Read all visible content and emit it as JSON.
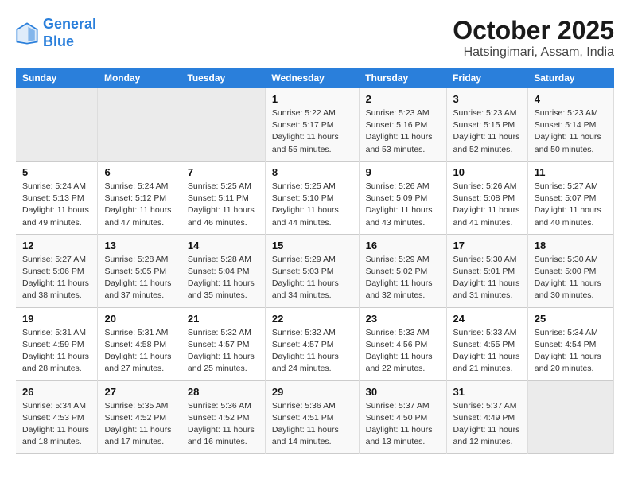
{
  "header": {
    "logo_line1": "General",
    "logo_line2": "Blue",
    "month": "October 2025",
    "location": "Hatsingimari, Assam, India"
  },
  "weekdays": [
    "Sunday",
    "Monday",
    "Tuesday",
    "Wednesday",
    "Thursday",
    "Friday",
    "Saturday"
  ],
  "weeks": [
    [
      {
        "day": "",
        "sunrise": "",
        "sunset": "",
        "daylight": ""
      },
      {
        "day": "",
        "sunrise": "",
        "sunset": "",
        "daylight": ""
      },
      {
        "day": "",
        "sunrise": "",
        "sunset": "",
        "daylight": ""
      },
      {
        "day": "1",
        "sunrise": "Sunrise: 5:22 AM",
        "sunset": "Sunset: 5:17 PM",
        "daylight": "Daylight: 11 hours and 55 minutes."
      },
      {
        "day": "2",
        "sunrise": "Sunrise: 5:23 AM",
        "sunset": "Sunset: 5:16 PM",
        "daylight": "Daylight: 11 hours and 53 minutes."
      },
      {
        "day": "3",
        "sunrise": "Sunrise: 5:23 AM",
        "sunset": "Sunset: 5:15 PM",
        "daylight": "Daylight: 11 hours and 52 minutes."
      },
      {
        "day": "4",
        "sunrise": "Sunrise: 5:23 AM",
        "sunset": "Sunset: 5:14 PM",
        "daylight": "Daylight: 11 hours and 50 minutes."
      }
    ],
    [
      {
        "day": "5",
        "sunrise": "Sunrise: 5:24 AM",
        "sunset": "Sunset: 5:13 PM",
        "daylight": "Daylight: 11 hours and 49 minutes."
      },
      {
        "day": "6",
        "sunrise": "Sunrise: 5:24 AM",
        "sunset": "Sunset: 5:12 PM",
        "daylight": "Daylight: 11 hours and 47 minutes."
      },
      {
        "day": "7",
        "sunrise": "Sunrise: 5:25 AM",
        "sunset": "Sunset: 5:11 PM",
        "daylight": "Daylight: 11 hours and 46 minutes."
      },
      {
        "day": "8",
        "sunrise": "Sunrise: 5:25 AM",
        "sunset": "Sunset: 5:10 PM",
        "daylight": "Daylight: 11 hours and 44 minutes."
      },
      {
        "day": "9",
        "sunrise": "Sunrise: 5:26 AM",
        "sunset": "Sunset: 5:09 PM",
        "daylight": "Daylight: 11 hours and 43 minutes."
      },
      {
        "day": "10",
        "sunrise": "Sunrise: 5:26 AM",
        "sunset": "Sunset: 5:08 PM",
        "daylight": "Daylight: 11 hours and 41 minutes."
      },
      {
        "day": "11",
        "sunrise": "Sunrise: 5:27 AM",
        "sunset": "Sunset: 5:07 PM",
        "daylight": "Daylight: 11 hours and 40 minutes."
      }
    ],
    [
      {
        "day": "12",
        "sunrise": "Sunrise: 5:27 AM",
        "sunset": "Sunset: 5:06 PM",
        "daylight": "Daylight: 11 hours and 38 minutes."
      },
      {
        "day": "13",
        "sunrise": "Sunrise: 5:28 AM",
        "sunset": "Sunset: 5:05 PM",
        "daylight": "Daylight: 11 hours and 37 minutes."
      },
      {
        "day": "14",
        "sunrise": "Sunrise: 5:28 AM",
        "sunset": "Sunset: 5:04 PM",
        "daylight": "Daylight: 11 hours and 35 minutes."
      },
      {
        "day": "15",
        "sunrise": "Sunrise: 5:29 AM",
        "sunset": "Sunset: 5:03 PM",
        "daylight": "Daylight: 11 hours and 34 minutes."
      },
      {
        "day": "16",
        "sunrise": "Sunrise: 5:29 AM",
        "sunset": "Sunset: 5:02 PM",
        "daylight": "Daylight: 11 hours and 32 minutes."
      },
      {
        "day": "17",
        "sunrise": "Sunrise: 5:30 AM",
        "sunset": "Sunset: 5:01 PM",
        "daylight": "Daylight: 11 hours and 31 minutes."
      },
      {
        "day": "18",
        "sunrise": "Sunrise: 5:30 AM",
        "sunset": "Sunset: 5:00 PM",
        "daylight": "Daylight: 11 hours and 30 minutes."
      }
    ],
    [
      {
        "day": "19",
        "sunrise": "Sunrise: 5:31 AM",
        "sunset": "Sunset: 4:59 PM",
        "daylight": "Daylight: 11 hours and 28 minutes."
      },
      {
        "day": "20",
        "sunrise": "Sunrise: 5:31 AM",
        "sunset": "Sunset: 4:58 PM",
        "daylight": "Daylight: 11 hours and 27 minutes."
      },
      {
        "day": "21",
        "sunrise": "Sunrise: 5:32 AM",
        "sunset": "Sunset: 4:57 PM",
        "daylight": "Daylight: 11 hours and 25 minutes."
      },
      {
        "day": "22",
        "sunrise": "Sunrise: 5:32 AM",
        "sunset": "Sunset: 4:57 PM",
        "daylight": "Daylight: 11 hours and 24 minutes."
      },
      {
        "day": "23",
        "sunrise": "Sunrise: 5:33 AM",
        "sunset": "Sunset: 4:56 PM",
        "daylight": "Daylight: 11 hours and 22 minutes."
      },
      {
        "day": "24",
        "sunrise": "Sunrise: 5:33 AM",
        "sunset": "Sunset: 4:55 PM",
        "daylight": "Daylight: 11 hours and 21 minutes."
      },
      {
        "day": "25",
        "sunrise": "Sunrise: 5:34 AM",
        "sunset": "Sunset: 4:54 PM",
        "daylight": "Daylight: 11 hours and 20 minutes."
      }
    ],
    [
      {
        "day": "26",
        "sunrise": "Sunrise: 5:34 AM",
        "sunset": "Sunset: 4:53 PM",
        "daylight": "Daylight: 11 hours and 18 minutes."
      },
      {
        "day": "27",
        "sunrise": "Sunrise: 5:35 AM",
        "sunset": "Sunset: 4:52 PM",
        "daylight": "Daylight: 11 hours and 17 minutes."
      },
      {
        "day": "28",
        "sunrise": "Sunrise: 5:36 AM",
        "sunset": "Sunset: 4:52 PM",
        "daylight": "Daylight: 11 hours and 16 minutes."
      },
      {
        "day": "29",
        "sunrise": "Sunrise: 5:36 AM",
        "sunset": "Sunset: 4:51 PM",
        "daylight": "Daylight: 11 hours and 14 minutes."
      },
      {
        "day": "30",
        "sunrise": "Sunrise: 5:37 AM",
        "sunset": "Sunset: 4:50 PM",
        "daylight": "Daylight: 11 hours and 13 minutes."
      },
      {
        "day": "31",
        "sunrise": "Sunrise: 5:37 AM",
        "sunset": "Sunset: 4:49 PM",
        "daylight": "Daylight: 11 hours and 12 minutes."
      },
      {
        "day": "",
        "sunrise": "",
        "sunset": "",
        "daylight": ""
      }
    ]
  ]
}
